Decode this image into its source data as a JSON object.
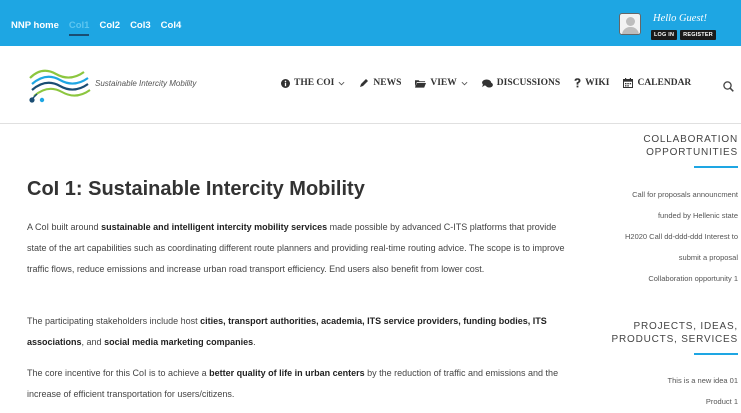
{
  "topbar": {
    "nav": [
      "NNP home",
      "Col1",
      "Col2",
      "Col3",
      "Col4"
    ],
    "active_index": 1,
    "greeting": "Hello Guest!",
    "login_label": "LOG IN",
    "register_label": "REGISTER"
  },
  "header": {
    "tagline": "Sustainable Intercity Mobility",
    "nav": [
      {
        "label": "THE COI",
        "icon": "info-icon",
        "dropdown": true
      },
      {
        "label": "NEWS",
        "icon": "pencil-icon",
        "dropdown": false
      },
      {
        "label": "VIEW",
        "icon": "folder-icon",
        "dropdown": true
      },
      {
        "label": "DISCUSSIONS",
        "icon": "chat-icon",
        "dropdown": false
      },
      {
        "label": "WIKI",
        "icon": "question-icon",
        "dropdown": false
      },
      {
        "label": "CALENDAR",
        "icon": "calendar-icon",
        "dropdown": false
      }
    ],
    "search_icon": "search-icon"
  },
  "main": {
    "title": "CoI 1: Sustainable Intercity Mobility",
    "p1": {
      "a": "A CoI built around ",
      "b": "sustainable and intelligent intercity mobility services",
      "c": " made possible by advanced C-ITS platforms that provide state of the art capabilities such as coordinating different route planners and providing real-time routing advice. The scope is to improve traffic flows, reduce emissions and increase urban road transport efficiency. End users also benefit from lower cost."
    },
    "p2": {
      "a": "The participating stakeholders include host ",
      "b": "cities, transport authorities, academia, ITS service providers, funding bodies, ITS associations",
      "c": ", and ",
      "d": "social media marketing companies",
      "e": "."
    },
    "p3": {
      "a": "The core incentive for this CoI is to achieve a ",
      "b": "better quality of life in urban centers",
      "c": " by the reduction of traffic and emissions and the increase of efficient transportation for users/citizens."
    }
  },
  "sidebar": {
    "collab": {
      "heading_l1": "COLLABORATION",
      "heading_l2": "OPPORTUNITIES",
      "links": [
        "Call for proposals announcment",
        "funded by Hellenic state",
        "H2020 Call dd-ddd-ddd Interest to",
        "submit a proposal",
        "Collaboration opportunity 1"
      ]
    },
    "projects": {
      "heading_l1": "PROJECTS, IDEAS,",
      "heading_l2": "PRODUCTS, SERVICES",
      "links": [
        "This is a new idea 01",
        "Product 1"
      ]
    }
  },
  "colors": {
    "topbar": "#1ea6e3",
    "accent": "#1ea6e3",
    "active_underline": "#1a4d73",
    "logo_green": "#8cc63f",
    "logo_blue": "#1ea6e3",
    "logo_navy": "#1a4d73"
  }
}
